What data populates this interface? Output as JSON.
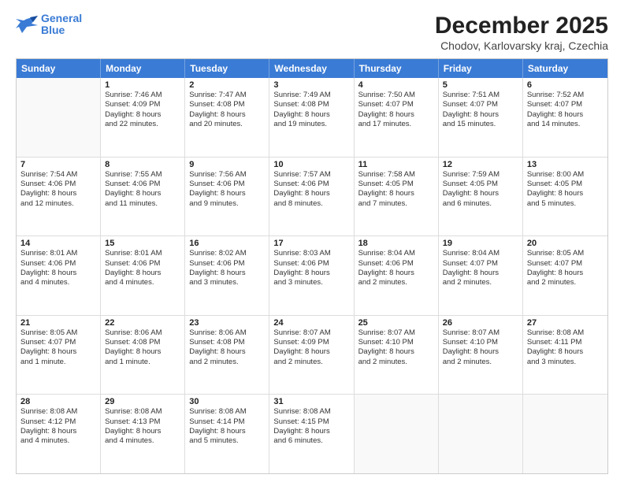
{
  "logo": {
    "line1": "General",
    "line2": "Blue"
  },
  "title": "December 2025",
  "subtitle": "Chodov, Karlovarsky kraj, Czechia",
  "header_days": [
    "Sunday",
    "Monday",
    "Tuesday",
    "Wednesday",
    "Thursday",
    "Friday",
    "Saturday"
  ],
  "weeks": [
    [
      {
        "day": "",
        "lines": []
      },
      {
        "day": "1",
        "lines": [
          "Sunrise: 7:46 AM",
          "Sunset: 4:09 PM",
          "Daylight: 8 hours",
          "and 22 minutes."
        ]
      },
      {
        "day": "2",
        "lines": [
          "Sunrise: 7:47 AM",
          "Sunset: 4:08 PM",
          "Daylight: 8 hours",
          "and 20 minutes."
        ]
      },
      {
        "day": "3",
        "lines": [
          "Sunrise: 7:49 AM",
          "Sunset: 4:08 PM",
          "Daylight: 8 hours",
          "and 19 minutes."
        ]
      },
      {
        "day": "4",
        "lines": [
          "Sunrise: 7:50 AM",
          "Sunset: 4:07 PM",
          "Daylight: 8 hours",
          "and 17 minutes."
        ]
      },
      {
        "day": "5",
        "lines": [
          "Sunrise: 7:51 AM",
          "Sunset: 4:07 PM",
          "Daylight: 8 hours",
          "and 15 minutes."
        ]
      },
      {
        "day": "6",
        "lines": [
          "Sunrise: 7:52 AM",
          "Sunset: 4:07 PM",
          "Daylight: 8 hours",
          "and 14 minutes."
        ]
      }
    ],
    [
      {
        "day": "7",
        "lines": [
          "Sunrise: 7:54 AM",
          "Sunset: 4:06 PM",
          "Daylight: 8 hours",
          "and 12 minutes."
        ]
      },
      {
        "day": "8",
        "lines": [
          "Sunrise: 7:55 AM",
          "Sunset: 4:06 PM",
          "Daylight: 8 hours",
          "and 11 minutes."
        ]
      },
      {
        "day": "9",
        "lines": [
          "Sunrise: 7:56 AM",
          "Sunset: 4:06 PM",
          "Daylight: 8 hours",
          "and 9 minutes."
        ]
      },
      {
        "day": "10",
        "lines": [
          "Sunrise: 7:57 AM",
          "Sunset: 4:06 PM",
          "Daylight: 8 hours",
          "and 8 minutes."
        ]
      },
      {
        "day": "11",
        "lines": [
          "Sunrise: 7:58 AM",
          "Sunset: 4:05 PM",
          "Daylight: 8 hours",
          "and 7 minutes."
        ]
      },
      {
        "day": "12",
        "lines": [
          "Sunrise: 7:59 AM",
          "Sunset: 4:05 PM",
          "Daylight: 8 hours",
          "and 6 minutes."
        ]
      },
      {
        "day": "13",
        "lines": [
          "Sunrise: 8:00 AM",
          "Sunset: 4:05 PM",
          "Daylight: 8 hours",
          "and 5 minutes."
        ]
      }
    ],
    [
      {
        "day": "14",
        "lines": [
          "Sunrise: 8:01 AM",
          "Sunset: 4:06 PM",
          "Daylight: 8 hours",
          "and 4 minutes."
        ]
      },
      {
        "day": "15",
        "lines": [
          "Sunrise: 8:01 AM",
          "Sunset: 4:06 PM",
          "Daylight: 8 hours",
          "and 4 minutes."
        ]
      },
      {
        "day": "16",
        "lines": [
          "Sunrise: 8:02 AM",
          "Sunset: 4:06 PM",
          "Daylight: 8 hours",
          "and 3 minutes."
        ]
      },
      {
        "day": "17",
        "lines": [
          "Sunrise: 8:03 AM",
          "Sunset: 4:06 PM",
          "Daylight: 8 hours",
          "and 3 minutes."
        ]
      },
      {
        "day": "18",
        "lines": [
          "Sunrise: 8:04 AM",
          "Sunset: 4:06 PM",
          "Daylight: 8 hours",
          "and 2 minutes."
        ]
      },
      {
        "day": "19",
        "lines": [
          "Sunrise: 8:04 AM",
          "Sunset: 4:07 PM",
          "Daylight: 8 hours",
          "and 2 minutes."
        ]
      },
      {
        "day": "20",
        "lines": [
          "Sunrise: 8:05 AM",
          "Sunset: 4:07 PM",
          "Daylight: 8 hours",
          "and 2 minutes."
        ]
      }
    ],
    [
      {
        "day": "21",
        "lines": [
          "Sunrise: 8:05 AM",
          "Sunset: 4:07 PM",
          "Daylight: 8 hours",
          "and 1 minute."
        ]
      },
      {
        "day": "22",
        "lines": [
          "Sunrise: 8:06 AM",
          "Sunset: 4:08 PM",
          "Daylight: 8 hours",
          "and 1 minute."
        ]
      },
      {
        "day": "23",
        "lines": [
          "Sunrise: 8:06 AM",
          "Sunset: 4:08 PM",
          "Daylight: 8 hours",
          "and 2 minutes."
        ]
      },
      {
        "day": "24",
        "lines": [
          "Sunrise: 8:07 AM",
          "Sunset: 4:09 PM",
          "Daylight: 8 hours",
          "and 2 minutes."
        ]
      },
      {
        "day": "25",
        "lines": [
          "Sunrise: 8:07 AM",
          "Sunset: 4:10 PM",
          "Daylight: 8 hours",
          "and 2 minutes."
        ]
      },
      {
        "day": "26",
        "lines": [
          "Sunrise: 8:07 AM",
          "Sunset: 4:10 PM",
          "Daylight: 8 hours",
          "and 2 minutes."
        ]
      },
      {
        "day": "27",
        "lines": [
          "Sunrise: 8:08 AM",
          "Sunset: 4:11 PM",
          "Daylight: 8 hours",
          "and 3 minutes."
        ]
      }
    ],
    [
      {
        "day": "28",
        "lines": [
          "Sunrise: 8:08 AM",
          "Sunset: 4:12 PM",
          "Daylight: 8 hours",
          "and 4 minutes."
        ]
      },
      {
        "day": "29",
        "lines": [
          "Sunrise: 8:08 AM",
          "Sunset: 4:13 PM",
          "Daylight: 8 hours",
          "and 4 minutes."
        ]
      },
      {
        "day": "30",
        "lines": [
          "Sunrise: 8:08 AM",
          "Sunset: 4:14 PM",
          "Daylight: 8 hours",
          "and 5 minutes."
        ]
      },
      {
        "day": "31",
        "lines": [
          "Sunrise: 8:08 AM",
          "Sunset: 4:15 PM",
          "Daylight: 8 hours",
          "and 6 minutes."
        ]
      },
      {
        "day": "",
        "lines": []
      },
      {
        "day": "",
        "lines": []
      },
      {
        "day": "",
        "lines": []
      }
    ]
  ]
}
